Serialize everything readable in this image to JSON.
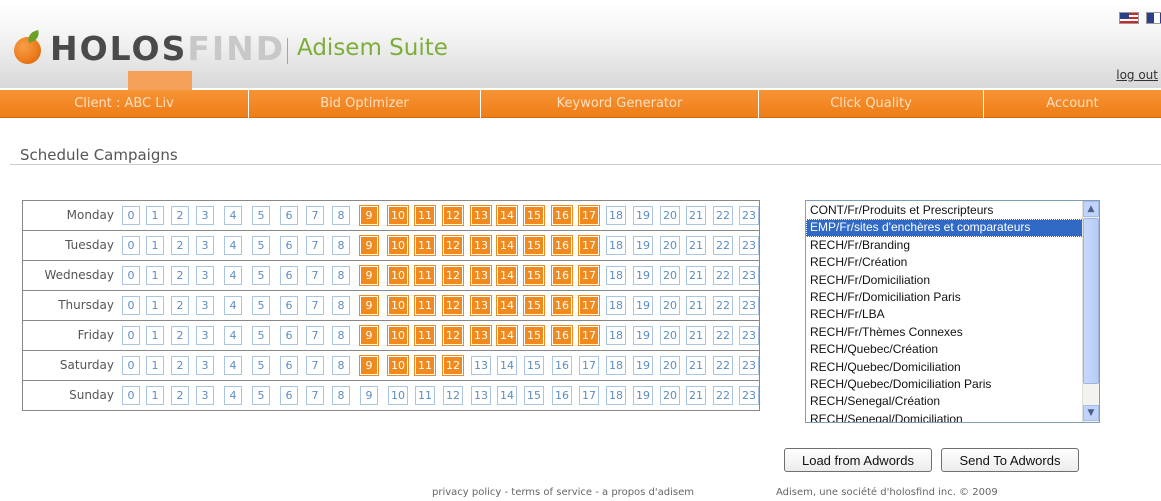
{
  "brand": {
    "name_bold": "HOLOS",
    "name_light": "FIND",
    "suite": "Adisem Suite"
  },
  "header": {
    "logout_label": "log out",
    "flags": [
      "us-flag-icon",
      "other-flag-icon"
    ]
  },
  "nav": {
    "items": [
      {
        "label": "Client : ABC Liv"
      },
      {
        "label": "Bid Optimizer"
      },
      {
        "label": "Keyword Generator"
      },
      {
        "label": "Click Quality"
      },
      {
        "label": "Account"
      }
    ]
  },
  "page": {
    "title": "Schedule Campaigns"
  },
  "schedule": {
    "hours": [
      "0",
      "1",
      "2",
      "3",
      "4",
      "5",
      "6",
      "7",
      "8",
      "9",
      "10",
      "11",
      "12",
      "13",
      "14",
      "15",
      "16",
      "17",
      "18",
      "19",
      "20",
      "21",
      "22",
      "23"
    ],
    "days": [
      {
        "label": "Monday",
        "active": [
          9,
          10,
          11,
          12,
          13,
          14,
          15,
          16,
          17
        ]
      },
      {
        "label": "Tuesday",
        "active": [
          9,
          10,
          11,
          12,
          13,
          14,
          15,
          16,
          17
        ]
      },
      {
        "label": "Wednesday",
        "active": [
          9,
          10,
          11,
          12,
          13,
          14,
          15,
          16,
          17
        ]
      },
      {
        "label": "Thursday",
        "active": [
          9,
          10,
          11,
          12,
          13,
          14,
          15,
          16,
          17
        ]
      },
      {
        "label": "Friday",
        "active": [
          9,
          10,
          11,
          12,
          13,
          14,
          15,
          16,
          17
        ]
      },
      {
        "label": "Saturday",
        "active": [
          9,
          10,
          11,
          12
        ]
      },
      {
        "label": "Sunday",
        "active": []
      }
    ],
    "colors": {
      "active": "#f08a1e",
      "inactive_text": "#5b8dc2"
    }
  },
  "campaigns": {
    "selected_index": 1,
    "items": [
      "CONT/Fr/Produits et Prescripteurs",
      "EMP/Fr/sites d'enchères et comparateurs",
      "RECH/Fr/Branding",
      "RECH/Fr/Création",
      "RECH/Fr/Domiciliation",
      "RECH/Fr/Domiciliation Paris",
      "RECH/Fr/LBA",
      "RECH/Fr/Thèmes Connexes",
      "RECH/Quebec/Création",
      "RECH/Quebec/Domiciliation",
      "RECH/Quebec/Domiciliation Paris",
      "RECH/Senegal/Création",
      "RECH/Senegal/Domiciliation"
    ]
  },
  "actions": {
    "load_label": "Load from Adwords",
    "send_label": "Send To Adwords"
  },
  "footer": {
    "links": "privacy policy - terms of service - a propos d'adisem",
    "copyright": "Adisem, une société d'holosfind inc. © 2009"
  }
}
